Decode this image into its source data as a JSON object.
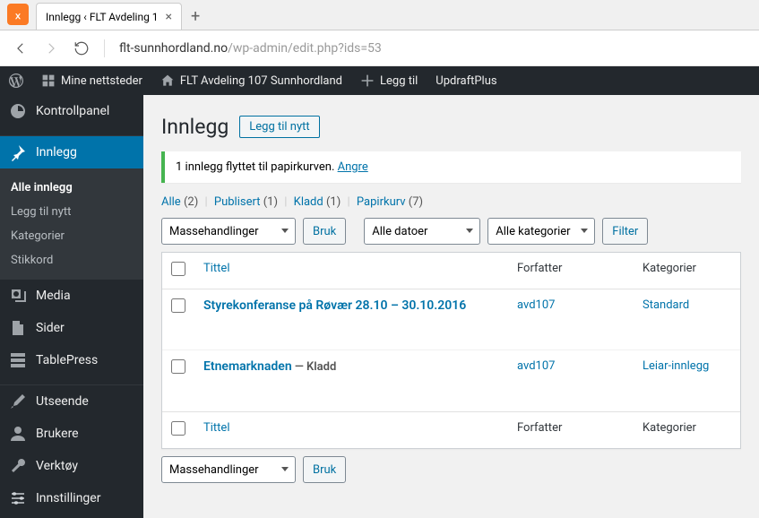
{
  "browser": {
    "tab_title": "Innlegg ‹ FLT Avdeling 1",
    "url_domain": "flt-sunnhordland.no",
    "url_path": "/wp-admin/edit.php?ids=53"
  },
  "adminbar": {
    "mysites": "Mine nettsteder",
    "sitename": "FLT Avdeling 107 Sunnhordland",
    "newcontent": "Legg til",
    "updraft": "UpdraftPlus"
  },
  "sidebar": {
    "dashboard": "Kontrollpanel",
    "posts": "Innlegg",
    "posts_sub": {
      "all": "Alle innlegg",
      "new": "Legg til nytt",
      "cats": "Kategorier",
      "tags": "Stikkord"
    },
    "media": "Media",
    "pages": "Sider",
    "tablepress": "TablePress",
    "appearance": "Utseende",
    "users": "Brukere",
    "tools": "Verktøy",
    "settings": "Innstillinger"
  },
  "page": {
    "heading": "Innlegg",
    "add_new": "Legg til nytt"
  },
  "notice": {
    "text": "1 innlegg flyttet til papirkurven. ",
    "undo": "Angre"
  },
  "filters": {
    "all": "Alle",
    "all_count": "(2)",
    "published": "Publisert",
    "published_count": "(1)",
    "draft": "Kladd",
    "draft_count": "(1)",
    "trash": "Papirkurv",
    "trash_count": "(7)"
  },
  "bulk": {
    "actions": "Massehandlinger",
    "apply": "Bruk",
    "dates": "Alle datoer",
    "cats": "Alle kategorier",
    "filter": "Filter"
  },
  "columns": {
    "title": "Tittel",
    "author": "Forfatter",
    "categories": "Kategorier"
  },
  "rows": [
    {
      "title": "Styrekonferanse på Røvær 28.10 – 30.10.2016",
      "state": "",
      "author": "avd107",
      "categories": "Standard"
    },
    {
      "title": "Etnemarknaden",
      "state": " — Kladd",
      "author": "avd107",
      "categories": "Leiar-innlegg"
    }
  ]
}
